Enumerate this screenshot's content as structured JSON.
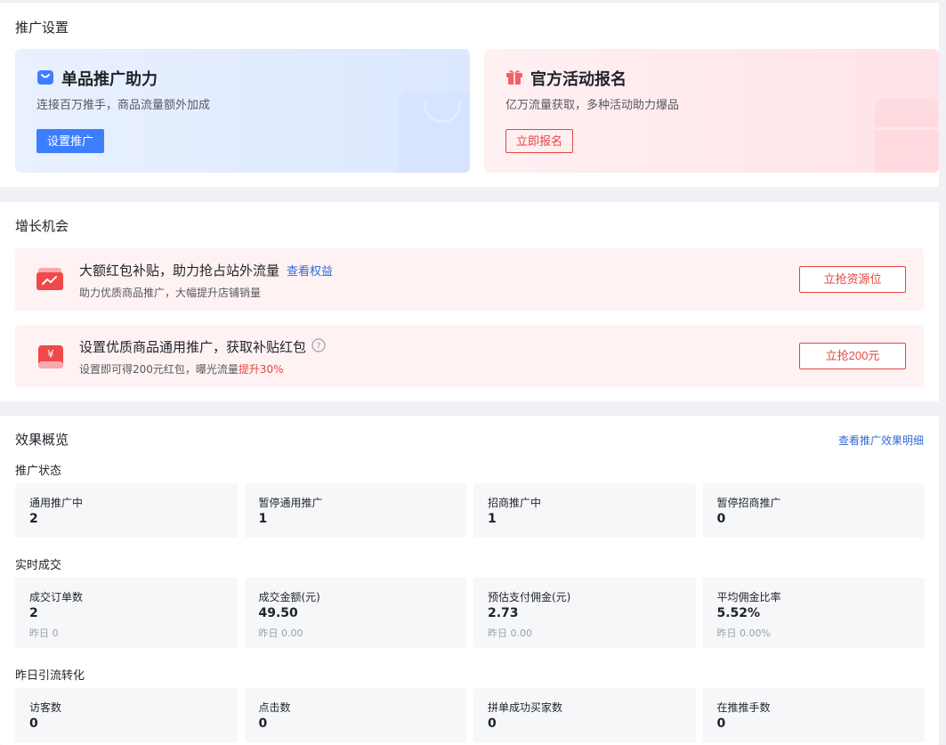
{
  "promo": {
    "title": "推广设置",
    "cards": [
      {
        "title": "单品推广助力",
        "desc": "连接百万推手，商品流量额外加成",
        "button": "设置推广"
      },
      {
        "title": "官方活动报名",
        "desc": "亿万流量获取，多种活动助力爆品",
        "button": "立即报名"
      }
    ]
  },
  "growth": {
    "title": "增长机会",
    "items": [
      {
        "title": "大额红包补贴，助力抢占站外流量",
        "link": "查看权益",
        "sub": "助力优质商品推广，大幅提升店铺销量",
        "button": "立抢资源位"
      },
      {
        "title": "设置优质商品通用推广，获取补贴红包",
        "sub": "设置即可得200元红包，曝光流量",
        "sub_highlight": "提升30%",
        "button": "立抢200元"
      }
    ]
  },
  "overview": {
    "title": "效果概览",
    "link": "查看推广效果明细",
    "groups": [
      {
        "label": "推广状态",
        "stats": [
          {
            "label": "通用推广中",
            "value": "2"
          },
          {
            "label": "暂停通用推广",
            "value": "1"
          },
          {
            "label": "招商推广中",
            "value": "1"
          },
          {
            "label": "暂停招商推广",
            "value": "0"
          }
        ]
      },
      {
        "label": "实时成交",
        "stats": [
          {
            "label": "成交订单数",
            "value": "2",
            "sub": "昨日 0"
          },
          {
            "label": "成交金额(元)",
            "value": "49.50",
            "sub": "昨日 0.00"
          },
          {
            "label": "预估支付佣金(元)",
            "value": "2.73",
            "sub": "昨日 0.00"
          },
          {
            "label": "平均佣金比率",
            "value": "5.52%",
            "sub": "昨日 0.00%"
          }
        ]
      },
      {
        "label": "昨日引流转化",
        "stats": [
          {
            "label": "访客数",
            "value": "0"
          },
          {
            "label": "点击数",
            "value": "0"
          },
          {
            "label": "拼单成功买家数",
            "value": "0"
          },
          {
            "label": "在推推手数",
            "value": "0"
          }
        ]
      }
    ]
  },
  "colors": {
    "primary": "#3d7eff",
    "danger": "#e5463f",
    "link": "#2f6bd7"
  }
}
